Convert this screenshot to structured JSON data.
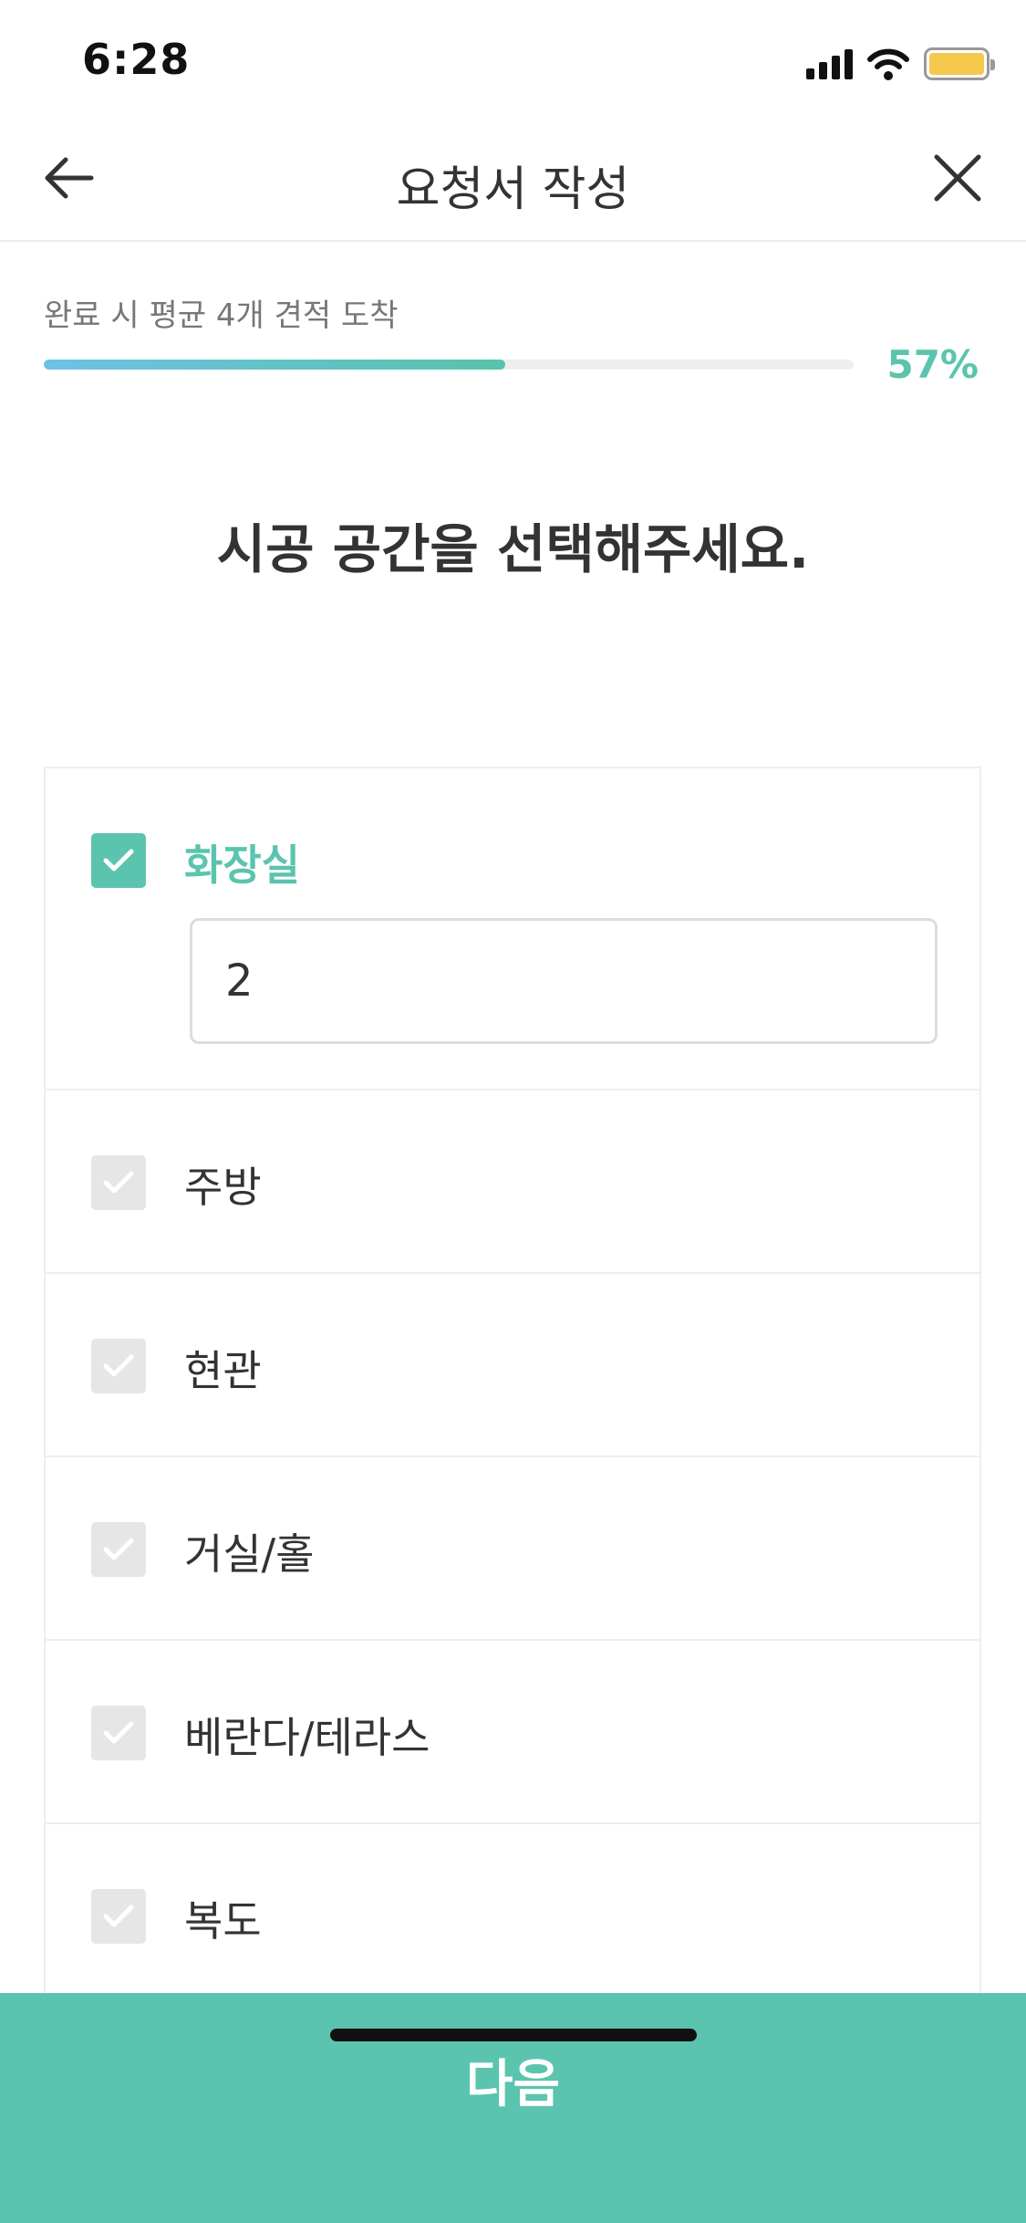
{
  "status_bar": {
    "time": "6:28",
    "icons": [
      "signal-icon",
      "wifi-icon",
      "battery-icon"
    ],
    "battery_color": "#f4c84a"
  },
  "nav": {
    "title": "요청서 작성",
    "back_icon": "arrow-left-icon",
    "close_icon": "close-icon"
  },
  "progress": {
    "caption": "완료 시 평균 4개 견적 도착",
    "value": 0.57,
    "percent_label": "57%"
  },
  "question": "시공 공간을 선택해주세요.",
  "options": [
    {
      "label": "화장실",
      "checked": true,
      "count": "2"
    },
    {
      "label": "주방",
      "checked": false
    },
    {
      "label": "현관",
      "checked": false
    },
    {
      "label": "거실/홀",
      "checked": false
    },
    {
      "label": "베란다/테라스",
      "checked": false
    },
    {
      "label": "복도",
      "checked": false
    }
  ],
  "next_button": {
    "label": "다음"
  },
  "colors": {
    "accent": "#5bc4ae",
    "progress_gradient_start": "#6ec1e4",
    "unchecked": "#e6e6e6"
  }
}
